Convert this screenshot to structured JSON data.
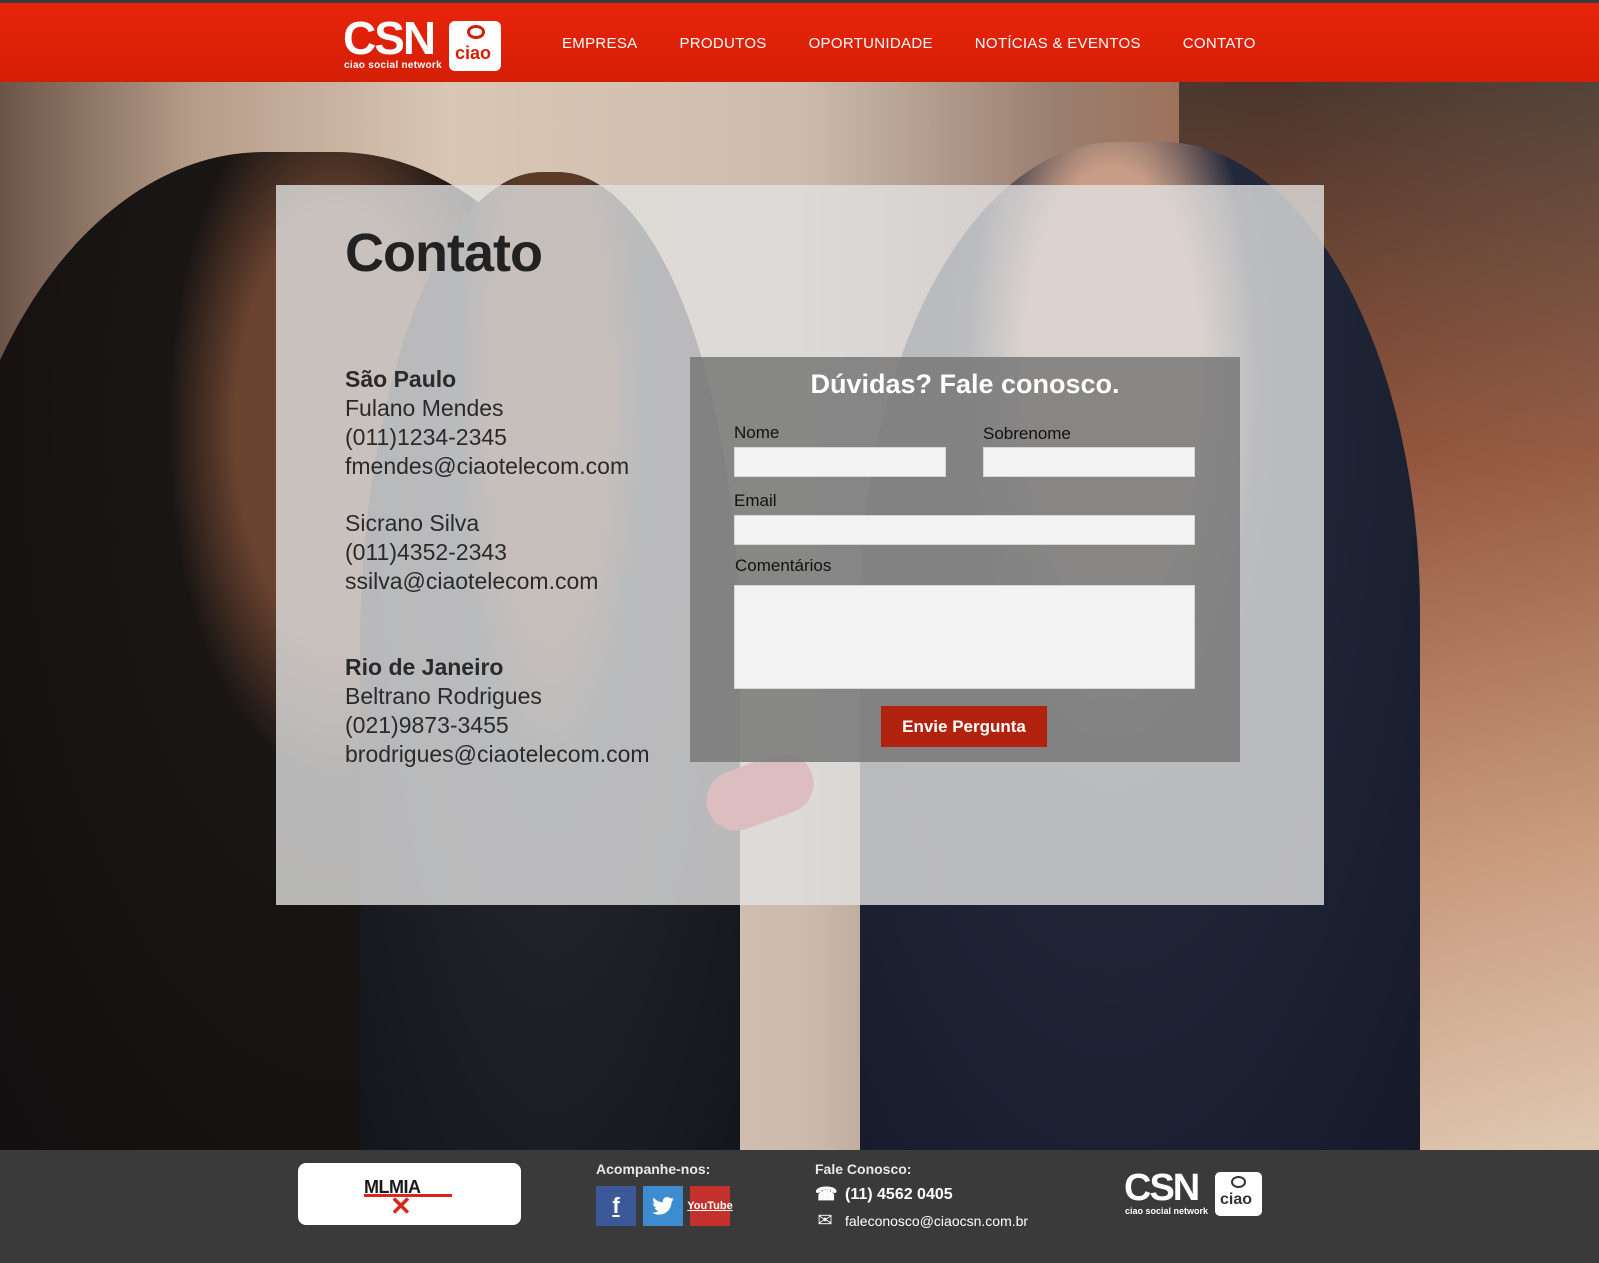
{
  "header": {
    "logo_text": "CSN",
    "logo_badge": "ciao",
    "logo_tagline": "ciao social network",
    "nav": [
      "EMPRESA",
      "PRODUTOS",
      "OPORTUNIDADE",
      "NOTÍCIAS & EVENTOS",
      "CONTATO"
    ]
  },
  "main": {
    "title": "Contato",
    "offices": [
      {
        "city": "São Paulo",
        "people": [
          {
            "name": "Fulano Mendes",
            "phone": "(011)1234-2345",
            "email": "fmendes@ciaotelecom.com"
          },
          {
            "name": "Sicrano Silva",
            "phone": "(011)4352-2343",
            "email": "ssilva@ciaotelecom.com"
          }
        ]
      },
      {
        "city": "Rio de Janeiro",
        "people": [
          {
            "name": "Beltrano Rodrigues",
            "phone": "(021)9873-3455",
            "email": "brodrigues@ciaotelecom.com"
          }
        ]
      }
    ]
  },
  "form": {
    "heading": "Dúvidas? Fale conosco.",
    "name_label": "Nome",
    "surname_label": "Sobrenome",
    "email_label": "Email",
    "comments_label": "Comentários",
    "submit_label": "Envie Pergunta"
  },
  "footer": {
    "partner_logo": "MLMIA",
    "follow_label": "Acompanhe-nos:",
    "social": [
      "facebook-icon",
      "twitter-icon",
      "youtube-icon"
    ],
    "youtube_text_1": "You",
    "youtube_text_2": "Tube",
    "contact_label": "Fale Conosco:",
    "phone": "(11) 4562 0405",
    "email": "faleconosco@ciaocsn.com.br",
    "logo_text": "CSN",
    "logo_badge": "ciao",
    "logo_tagline": "ciao social network"
  },
  "colors": {
    "brand_red": "#d41f06",
    "button_red": "#b2230f",
    "footer_bg": "#3a3a3a"
  }
}
